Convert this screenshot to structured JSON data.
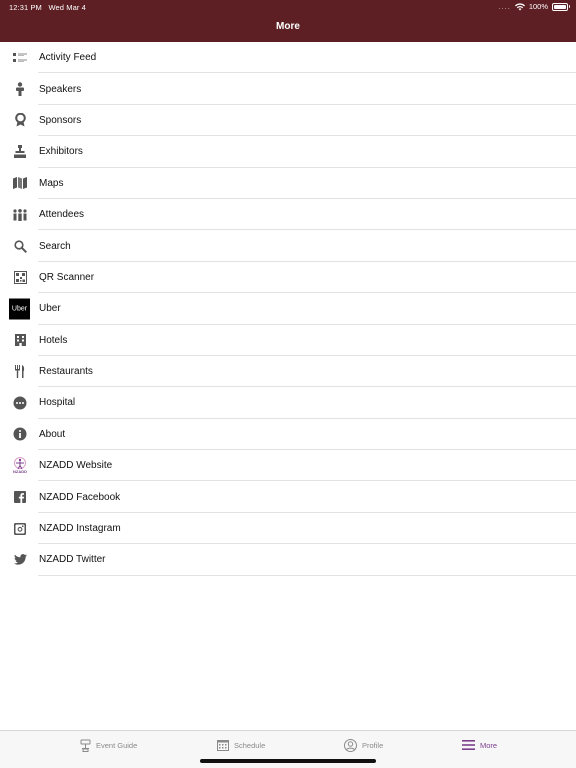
{
  "status": {
    "time": "12:31 PM",
    "date": "Wed Mar 4",
    "dots": "....",
    "battery": "100%"
  },
  "header": {
    "title": "More"
  },
  "menu": [
    {
      "label": "Activity Feed",
      "icon": "activity-feed-icon"
    },
    {
      "label": "Speakers",
      "icon": "speaker-icon"
    },
    {
      "label": "Sponsors",
      "icon": "sponsor-ribbon-icon"
    },
    {
      "label": "Exhibitors",
      "icon": "exhibitor-icon"
    },
    {
      "label": "Maps",
      "icon": "map-icon"
    },
    {
      "label": "Attendees",
      "icon": "attendees-icon"
    },
    {
      "label": "Search",
      "icon": "search-icon"
    },
    {
      "label": "QR Scanner",
      "icon": "qr-code-icon"
    },
    {
      "label": "Uber",
      "icon": "uber-logo-icon",
      "logo_text": "Uber"
    },
    {
      "label": "Hotels",
      "icon": "hotel-building-icon"
    },
    {
      "label": "Restaurants",
      "icon": "fork-knife-icon"
    },
    {
      "label": "Hospital",
      "icon": "more-dots-icon"
    },
    {
      "label": "About",
      "icon": "info-icon"
    },
    {
      "label": "NZADD Website",
      "icon": "nzadd-logo-icon",
      "logo_text": "NZADD"
    },
    {
      "label": "NZADD Facebook",
      "icon": "facebook-icon"
    },
    {
      "label": "NZADD Instagram",
      "icon": "instagram-icon"
    },
    {
      "label": "NZADD Twitter",
      "icon": "twitter-icon"
    }
  ],
  "tabs": [
    {
      "label": "Event Guide",
      "icon": "event-guide-icon",
      "active": false
    },
    {
      "label": "Schedule",
      "icon": "calendar-icon",
      "active": false
    },
    {
      "label": "Profile",
      "icon": "profile-icon",
      "active": false
    },
    {
      "label": "More",
      "icon": "hamburger-menu-icon",
      "active": true
    }
  ],
  "colors": {
    "header_bg": "#5d1f24",
    "active_tab": "#7b3f8c",
    "icon": "#555555"
  }
}
